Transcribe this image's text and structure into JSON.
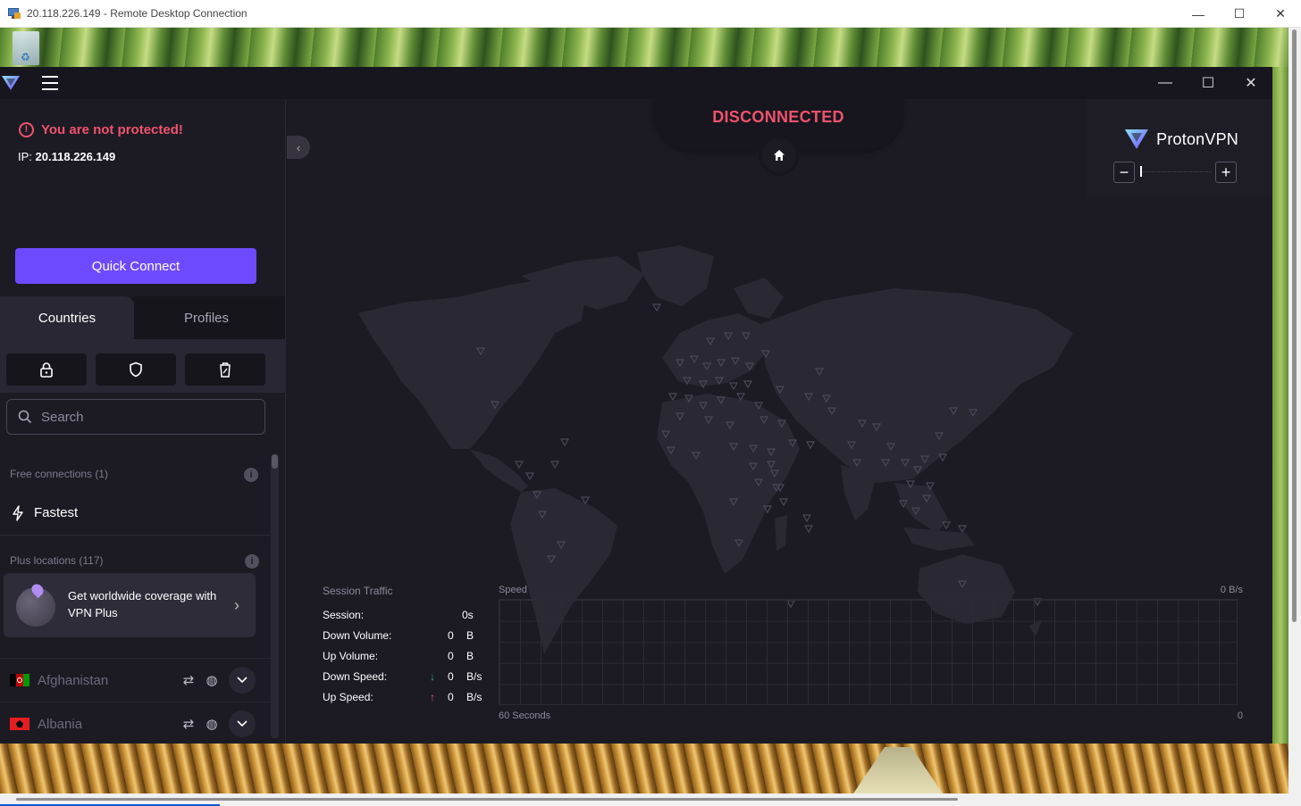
{
  "window": {
    "title": "20.118.226.149 - Remote Desktop Connection",
    "controls": [
      "minimize",
      "maximize",
      "close"
    ]
  },
  "app": {
    "name": "ProtonVPN",
    "status": "DISCONNECTED",
    "warning": "You are not protected!",
    "ip_label": "IP:",
    "ip": "20.118.226.149",
    "quick_connect": "Quick Connect",
    "tabs": [
      "Countries",
      "Profiles"
    ],
    "filter_icons": [
      "lock-icon",
      "shield-icon",
      "trash-icon"
    ],
    "search_placeholder": "Search",
    "sections": {
      "free": "Free connections (1)",
      "plus": "Plus locations (117)"
    },
    "fastest": "Fastest",
    "upsell": "Get worldwide coverage with VPN Plus",
    "countries": [
      {
        "name": "Afghanistan",
        "flag_color": "#000000"
      },
      {
        "name": "Albania",
        "flag_color": "#e41e20"
      }
    ]
  },
  "traffic": {
    "title": "Session Traffic",
    "rows": [
      {
        "label": "Session:",
        "value": "0s",
        "unit": "",
        "arrow": ""
      },
      {
        "label": "Down Volume:",
        "value": "0",
        "unit": "B",
        "arrow": ""
      },
      {
        "label": "Up Volume:",
        "value": "0",
        "unit": "B",
        "arrow": ""
      },
      {
        "label": "Down Speed:",
        "value": "0",
        "unit": "B/s",
        "arrow": "↓"
      },
      {
        "label": "Up Speed:",
        "value": "0",
        "unit": "B/s",
        "arrow": "↑"
      }
    ],
    "speed_label": "Speed",
    "speed_max": "0  B/s",
    "x_label": "60 Seconds",
    "x_zero": "0"
  },
  "colors": {
    "accent": "#6d4aff",
    "danger": "#f0526d",
    "background": "#1c1b24",
    "map_land": "#2a2833",
    "down_arrow": "#2bb673",
    "up_arrow": "#f0526d"
  }
}
